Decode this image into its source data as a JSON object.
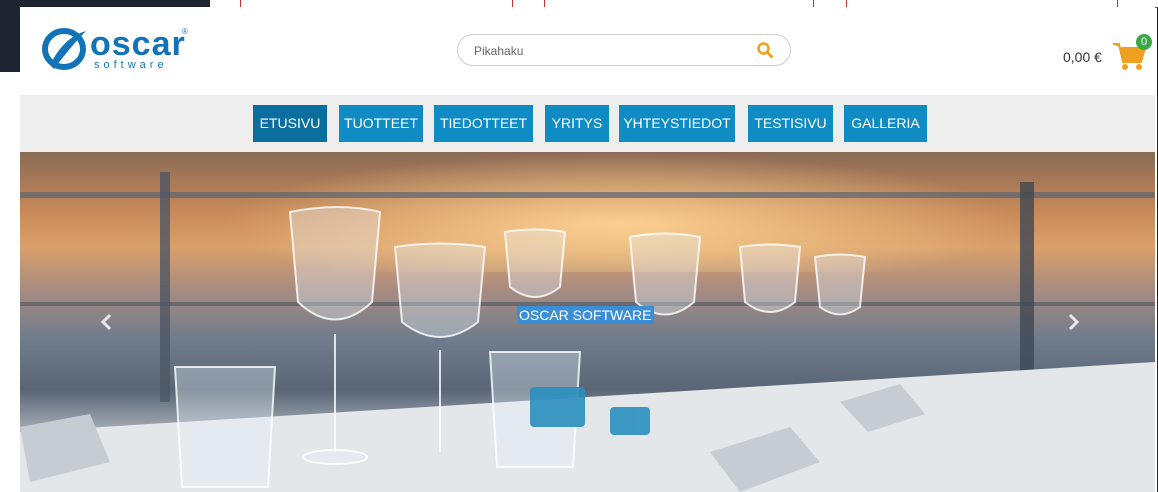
{
  "header": {
    "logo": {
      "wordmark": "oscar",
      "registered": "®",
      "tagline": "software"
    },
    "search": {
      "placeholder": "Pikahaku",
      "value": ""
    },
    "cart": {
      "total": "0,00 €",
      "count": "0"
    }
  },
  "nav": {
    "items": [
      {
        "label": "ETUSIVU",
        "active": true
      },
      {
        "label": "TUOTTEET",
        "active": false
      },
      {
        "label": "TIEDOTTEET",
        "active": false
      },
      {
        "label": "YRITYS",
        "active": false
      },
      {
        "label": "YHTEYSTIEDOT",
        "active": false
      },
      {
        "label": "TESTISIVU",
        "active": false
      },
      {
        "label": "GALLERIA",
        "active": false
      }
    ]
  },
  "hero": {
    "caption": "OSCAR SOFTWARE"
  },
  "colors": {
    "brand": "#1273b8",
    "nav": "#0f8cc4",
    "nav_active": "#0a6f9f",
    "search_icon": "#f0a020",
    "cart_icon": "#f0a020",
    "badge": "#3aa845"
  },
  "icons": {
    "search": "magnifier-icon",
    "cart": "cart-icon",
    "prev": "chevron-left-icon",
    "next": "chevron-right-icon"
  }
}
